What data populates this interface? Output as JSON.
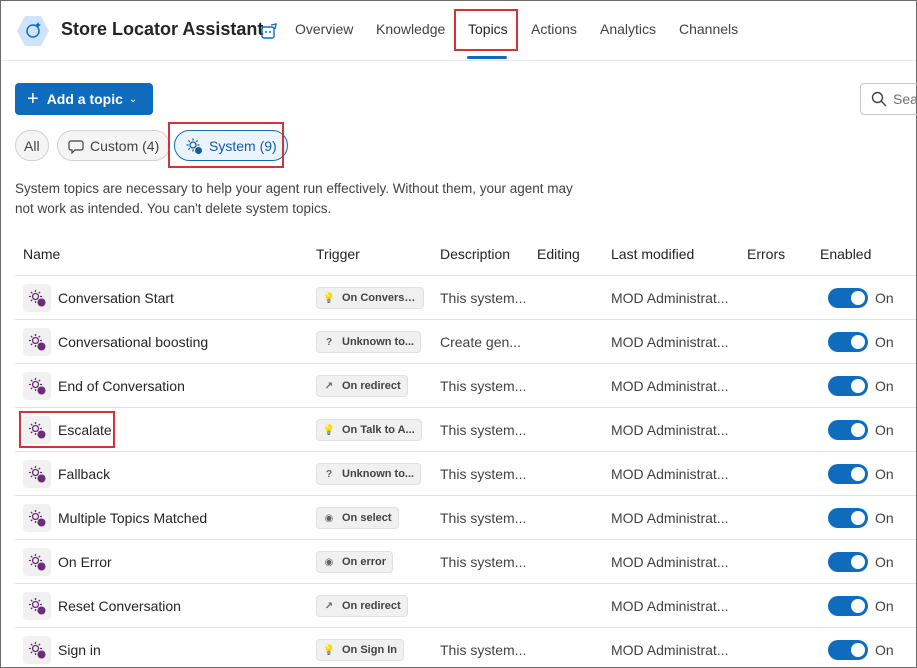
{
  "header": {
    "app_title": "Store Locator Assistant",
    "tabs": [
      {
        "label": "Overview"
      },
      {
        "label": "Knowledge"
      },
      {
        "label": "Topics"
      },
      {
        "label": "Actions"
      },
      {
        "label": "Analytics"
      },
      {
        "label": "Channels"
      }
    ],
    "active_tab": "Topics"
  },
  "toolbar": {
    "add_topic_label": "Add a topic",
    "search_placeholder": "Sea"
  },
  "filters": [
    {
      "label": "All"
    },
    {
      "label": "Custom (4)"
    },
    {
      "label": "System (9)",
      "selected": true
    }
  ],
  "info_text": "System topics are necessary to help your agent run effectively. Without them, your agent may not work as intended. You can't delete system topics.",
  "table": {
    "columns": [
      "Name",
      "Trigger",
      "Description",
      "Editing",
      "Last modified",
      "Errors",
      "Enabled"
    ],
    "rows": [
      {
        "name": "Conversation Start",
        "trigger_icon": "lightbulb",
        "trigger": "On Conversa...",
        "description": "This system...",
        "modified": "MOD Administrat...",
        "enabled": "On"
      },
      {
        "name": "Conversational boosting",
        "trigger_icon": "question",
        "trigger": "Unknown to...",
        "description": "Create gen...",
        "modified": "MOD Administrat...",
        "enabled": "On"
      },
      {
        "name": "End of Conversation",
        "trigger_icon": "redirect",
        "trigger": "On redirect",
        "description": "This system...",
        "modified": "MOD Administrat...",
        "enabled": "On"
      },
      {
        "name": "Escalate",
        "trigger_icon": "lightbulb",
        "trigger": "On Talk to A...",
        "description": "This system...",
        "modified": "MOD Administrat...",
        "enabled": "On"
      },
      {
        "name": "Fallback",
        "trigger_icon": "question",
        "trigger": "Unknown to...",
        "description": "This system...",
        "modified": "MOD Administrat...",
        "enabled": "On"
      },
      {
        "name": "Multiple Topics Matched",
        "trigger_icon": "select",
        "trigger": "On select",
        "description": "This system...",
        "modified": "MOD Administrat...",
        "enabled": "On"
      },
      {
        "name": "On Error",
        "trigger_icon": "error",
        "trigger": "On error",
        "description": "This system...",
        "modified": "MOD Administrat...",
        "enabled": "On"
      },
      {
        "name": "Reset Conversation",
        "trigger_icon": "redirect",
        "trigger": "On redirect",
        "description": "",
        "modified": "MOD Administrat...",
        "enabled": "On"
      },
      {
        "name": "Sign in",
        "trigger_icon": "lightbulb",
        "trigger": "On Sign In",
        "description": "This system...",
        "modified": "MOD Administrat...",
        "enabled": "On"
      }
    ]
  },
  "colors": {
    "accent": "#0f6cbd",
    "highlight_border": "#d13438",
    "topic_icon": "#6b2c7a"
  }
}
